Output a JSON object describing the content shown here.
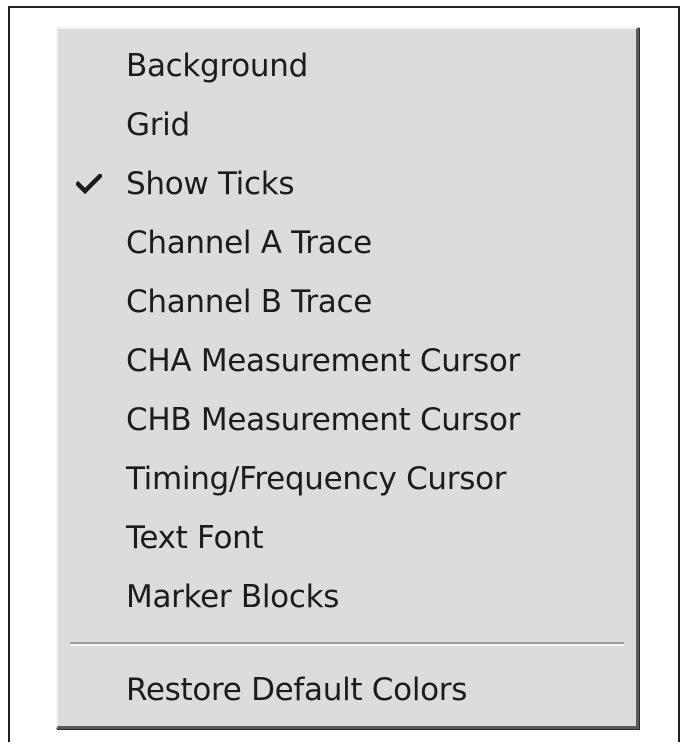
{
  "menu": {
    "items": [
      {
        "label": "Background",
        "checked": false
      },
      {
        "label": "Grid",
        "checked": false
      },
      {
        "label": "Show Ticks",
        "checked": true
      },
      {
        "label": "Channel A Trace",
        "checked": false
      },
      {
        "label": "Channel B Trace",
        "checked": false
      },
      {
        "label": "CHA Measurement Cursor",
        "checked": false
      },
      {
        "label": "CHB Measurement Cursor",
        "checked": false
      },
      {
        "label": "Timing/Frequency Cursor",
        "checked": false
      },
      {
        "label": "Text Font",
        "checked": false
      },
      {
        "label": "Marker Blocks",
        "checked": false
      }
    ],
    "footer_item": {
      "label": "Restore Default Colors"
    },
    "check_icon": "checkmark-icon"
  }
}
